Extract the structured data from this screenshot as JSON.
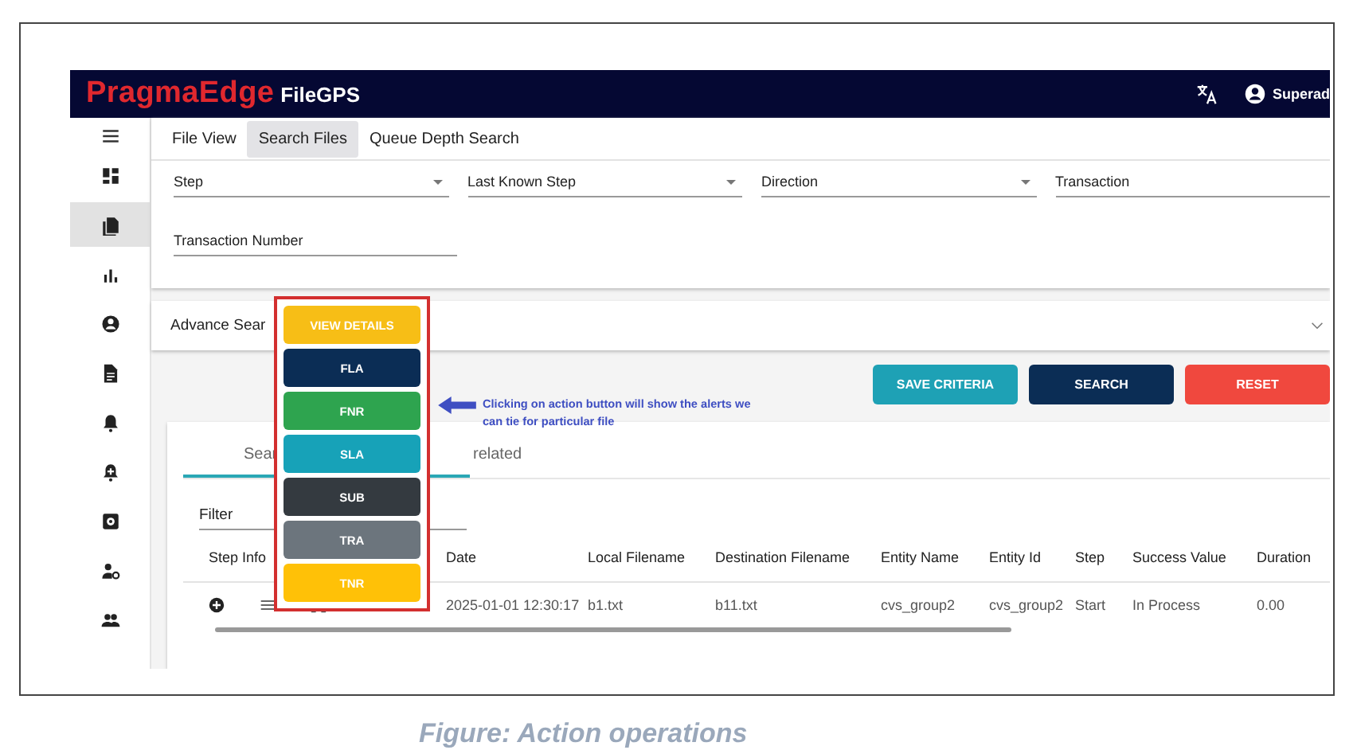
{
  "header": {
    "brand": "PragmaEdge",
    "product": "FileGPS",
    "user": "Superad"
  },
  "sidebar": {
    "items": [
      {
        "selected": false
      },
      {
        "selected": true
      },
      {
        "selected": false
      },
      {
        "selected": false
      },
      {
        "selected": false
      },
      {
        "selected": false
      },
      {
        "selected": false
      },
      {
        "selected": false
      },
      {
        "selected": false
      },
      {
        "selected": false
      }
    ]
  },
  "tabs": [
    {
      "label": "File View",
      "selected": false
    },
    {
      "label": "Search Files",
      "selected": true
    },
    {
      "label": "Queue Depth Search",
      "selected": false
    }
  ],
  "filters": {
    "selects": [
      "Step",
      "Last Known Step",
      "Direction",
      "Transaction"
    ],
    "field": "Transaction Number"
  },
  "advance_search": "Advance Sear",
  "buttons": [
    {
      "label": "SAVE CRITERIA",
      "color": "#1ea1b5"
    },
    {
      "label": "SEARCH",
      "color": "#0b2d55"
    },
    {
      "label": "RESET",
      "color": "#f0483e"
    }
  ],
  "results": {
    "tabs": [
      {
        "label": "Sear",
        "selected": true
      },
      {
        "label": "related",
        "selected": false
      }
    ],
    "filter": "Filter",
    "step_info_header": "Step Info",
    "columns": [
      "Date",
      "Local Filename",
      "Destination Filename",
      "Entity Name",
      "Entity Id",
      "Step",
      "Success Value",
      "Duration"
    ],
    "rows": [
      {
        "cells": [
          "2025-01-01 12:30:17",
          "b1.txt",
          "b11.txt",
          "cvs_group2",
          "cvs_group2",
          "Start",
          "In Process",
          "0.00"
        ]
      }
    ]
  },
  "action_menu": [
    {
      "label": "VIEW DETAILS",
      "color": "#f7be16"
    },
    {
      "label": "FLA",
      "color": "#0b2d55"
    },
    {
      "label": "FNR",
      "color": "#2ea44f"
    },
    {
      "label": "SLA",
      "color": "#17a2b8"
    },
    {
      "label": "SUB",
      "color": "#343a40"
    },
    {
      "label": "TRA",
      "color": "#6c757d"
    },
    {
      "label": "TNR",
      "color": "#ffc107"
    }
  ],
  "note": {
    "lines": [
      "Clicking on action button will show the alerts we",
      "can tie for particular file"
    ]
  },
  "caption": "Figure: Action operations"
}
